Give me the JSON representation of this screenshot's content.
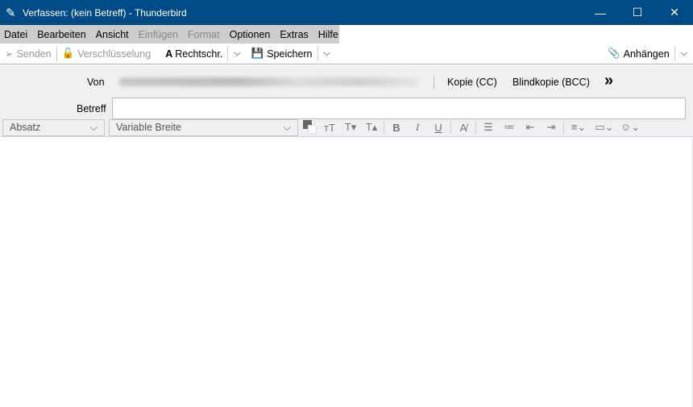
{
  "window": {
    "title": "Verfassen: (kein Betreff) - Thunderbird",
    "minimize": "—",
    "maximize": "☐",
    "close": "✕"
  },
  "menu": [
    {
      "label": "Datei",
      "enabled": true
    },
    {
      "label": "Bearbeiten",
      "enabled": true
    },
    {
      "label": "Ansicht",
      "enabled": true
    },
    {
      "label": "Einfügen",
      "enabled": false
    },
    {
      "label": "Format",
      "enabled": false
    },
    {
      "label": "Optionen",
      "enabled": true
    },
    {
      "label": "Extras",
      "enabled": true
    },
    {
      "label": "Hilfe",
      "enabled": true
    }
  ],
  "toolbar": {
    "send": "Senden",
    "encryption": "Verschlüsselung",
    "spelling": "Rechtschr.",
    "save": "Speichern",
    "attach": "Anhängen"
  },
  "header": {
    "from_label": "Von",
    "cc": "Kopie (CC)",
    "bcc": "Blindkopie (BCC)",
    "more": "»",
    "subject_label": "Betreff",
    "subject_value": ""
  },
  "format": {
    "paragraph": "Absatz",
    "font": "Variable Breite"
  }
}
